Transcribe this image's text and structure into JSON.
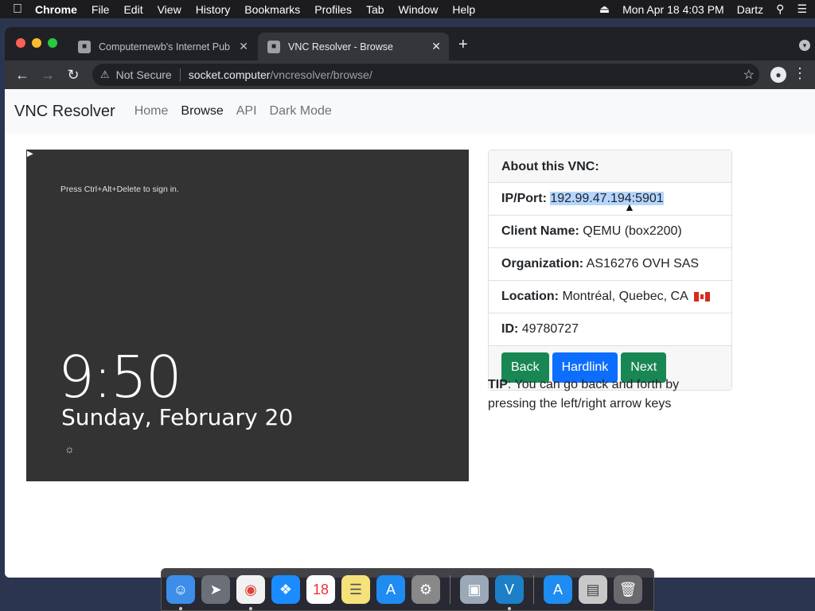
{
  "menubar": {
    "apple": "",
    "items": [
      "Chrome",
      "File",
      "Edit",
      "View",
      "History",
      "Bookmarks",
      "Profiles",
      "Tab",
      "Window",
      "Help"
    ],
    "status_eject": "⏏",
    "datetime": "Mon Apr 18  4:03 PM",
    "user": "Dartz"
  },
  "browser": {
    "tabs": [
      {
        "label": "Computernewb's Internet Pub"
      },
      {
        "label": "VNC Resolver - Browse"
      }
    ],
    "url_security": "Not Secure",
    "url_host": "socket.computer",
    "url_path": "/vncresolver/browse/"
  },
  "page": {
    "brand": "VNC Resolver",
    "nav": [
      "Home",
      "Browse",
      "API",
      "Dark Mode"
    ],
    "screen": {
      "hint": "Press Ctrl+Alt+Delete to sign in.",
      "time": "9:50",
      "date": "Sunday, February 20"
    },
    "about": {
      "header": "About this VNC:",
      "ip_label": "IP/Port:",
      "ip_value": "192.99.47.194:5901",
      "client_label": "Client Name:",
      "client_value": "QEMU (box2200)",
      "org_label": "Organization:",
      "org_value": "AS16276 OVH SAS",
      "loc_label": "Location:",
      "loc_value": "Montréal, Quebec, CA",
      "id_label": "ID:",
      "id_value": "49780727"
    },
    "buttons": {
      "back": "Back",
      "hardlink": "Hardlink",
      "next": "Next"
    },
    "tip_label": "TIP",
    "tip_text": ": You can go back and forth by pressing the left/right arrow keys"
  }
}
